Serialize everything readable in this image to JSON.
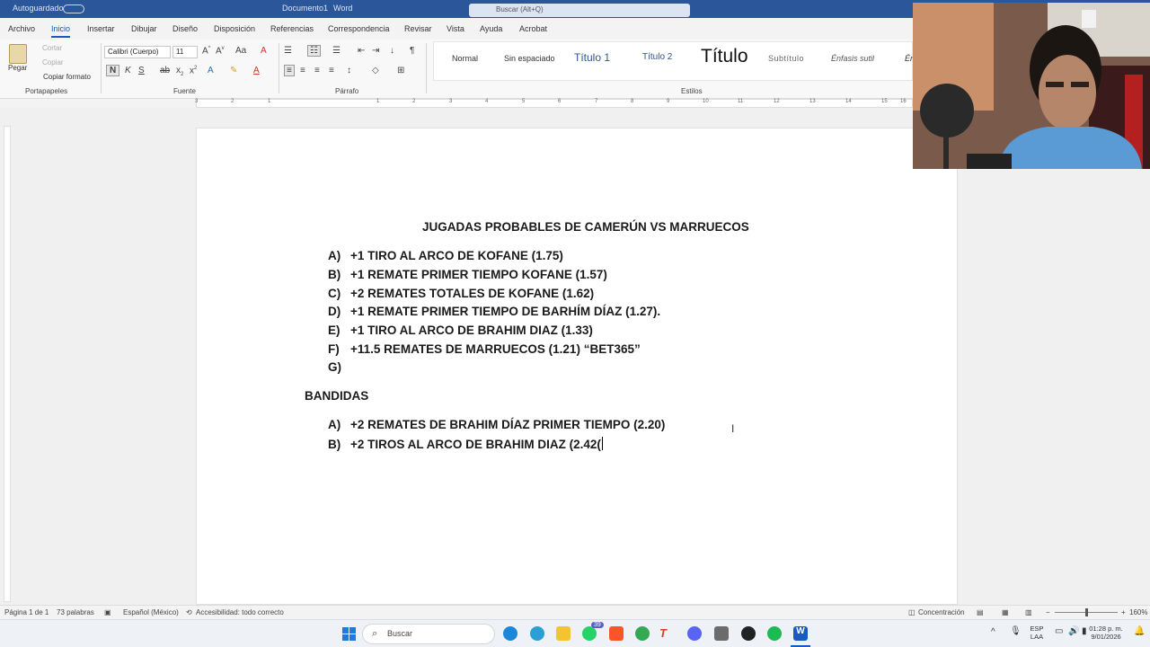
{
  "titlebar": {
    "autosave": "Autoguardado",
    "doc_name": "Documento1",
    "app": "Word",
    "search": "Buscar (Alt+Q)"
  },
  "menu": [
    "Archivo",
    "Inicio",
    "Insertar",
    "Dibujar",
    "Diseño",
    "Disposición",
    "Referencias",
    "Correspondencia",
    "Revisar",
    "Vista",
    "Ayuda",
    "Acrobat"
  ],
  "ribbon": {
    "clipboard": {
      "paste": "Pegar",
      "cut": "Cortar",
      "copy": "Copiar",
      "format_painter": "Copiar formato",
      "label": "Portapapeles"
    },
    "font": {
      "name": "Calibri (Cuerpo)",
      "size": "11",
      "label": "Fuente",
      "bold": "N",
      "italic": "K",
      "underline": "S"
    },
    "paragraph": {
      "label": "Párrafo"
    },
    "styles": {
      "label": "Estilos",
      "items": [
        "Normal",
        "Sin espaciado",
        "Título 1",
        "Título 2",
        "Título",
        "Subtítulo",
        "Énfasis sutil",
        "Én"
      ]
    }
  },
  "ruler": [
    "3",
    "2",
    "1",
    "1",
    "2",
    "3",
    "4",
    "5",
    "6",
    "7",
    "8",
    "9",
    "10",
    "11",
    "12",
    "13",
    "14",
    "15",
    "16"
  ],
  "document": {
    "title": "JUGADAS PROBABLES DE CAMERÚN VS MARRUECOS",
    "items": [
      {
        "key": "A)",
        "text": "+1 TIRO AL ARCO DE KOFANE (1.75)"
      },
      {
        "key": "B)",
        "text": "+1 REMATE PRIMER TIEMPO KOFANE (1.57)"
      },
      {
        "key": "C)",
        "text": "+2 REMATES TOTALES DE KOFANE (1.62)"
      },
      {
        "key": "D)",
        "text": "+1 REMATE PRIMER TIEMPO DE BARHÍM DÍAZ (1.27)."
      },
      {
        "key": "E)",
        "text": "+1 TIRO AL ARCO DE BRAHIM DIAZ (1.33)"
      },
      {
        "key": "F)",
        "text": "+11.5 REMATES DE MARRUECOS (1.21) “BET365”"
      },
      {
        "key": "G)",
        "text": ""
      }
    ],
    "section2": "BANDIDAS",
    "items2": [
      {
        "key": "A)",
        "text": "+2 REMATES DE BRAHIM DÍAZ PRIMER TIEMPO (2.20)"
      },
      {
        "key": "B)",
        "text": "+2 TIROS AL ARCO DE BRAHIM DIAZ (2.42("
      }
    ]
  },
  "status": {
    "page": "Página 1 de 1",
    "words": "73 palabras",
    "language": "Español (México)",
    "accessibility": "Accesibilidad: todo correcto",
    "focus": "Concentración",
    "zoom": "160%"
  },
  "taskbar": {
    "search": "Buscar",
    "badge": "39",
    "lang1": "ESP",
    "lang2": "LAA",
    "time": "01:28 p. m.",
    "date": "9/01/2026"
  }
}
